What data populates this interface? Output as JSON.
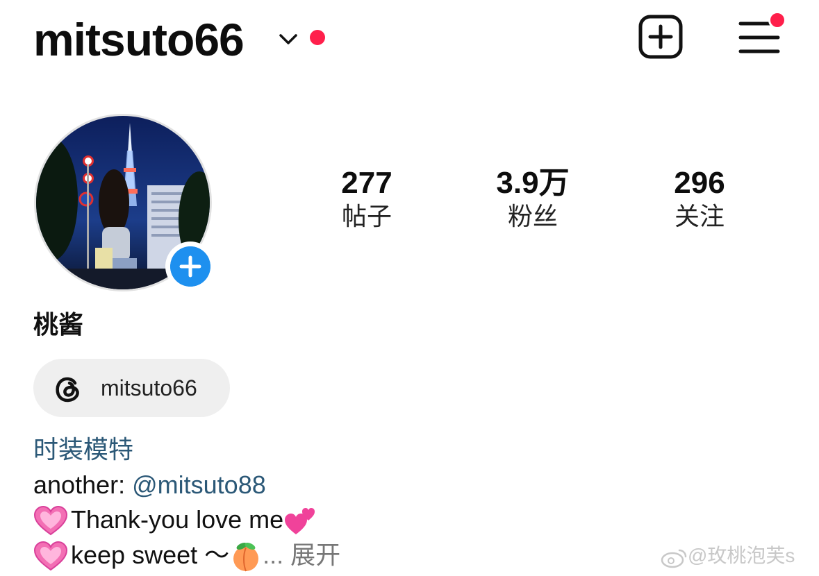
{
  "header": {
    "username": "mitsuto66",
    "has_notification_dot": true,
    "menu_has_notification_dot": true,
    "icons": [
      "chevron-down-icon",
      "notification-dot-icon",
      "create-post-icon",
      "hamburger-menu-icon"
    ],
    "accent_dot_color": "#ff1f4b"
  },
  "profile": {
    "avatar_icon": "profile-photo",
    "add_story_icon": "plus-icon",
    "add_story_color": "#1e90ef",
    "display_name": "桃酱"
  },
  "stats": {
    "posts_count": "277",
    "posts_label": "帖子",
    "followers_count": "3.9万",
    "followers_label": "粉丝",
    "following_count": "296",
    "following_label": "关注"
  },
  "threads": {
    "icon": "threads-icon",
    "handle": "mitsuto66"
  },
  "bio": {
    "category": "时装模特",
    "line1_prefix": "another: ",
    "line1_mention": "@mitsuto88",
    "line2_text": "Thank-you love me",
    "line3_text": "keep sweet ～",
    "line3_ellipsis": "...",
    "more_label": "展开",
    "mention_color": "#2b5877"
  },
  "watermark": {
    "icon": "weibo-icon",
    "text": "@玫桃泡芙s"
  }
}
